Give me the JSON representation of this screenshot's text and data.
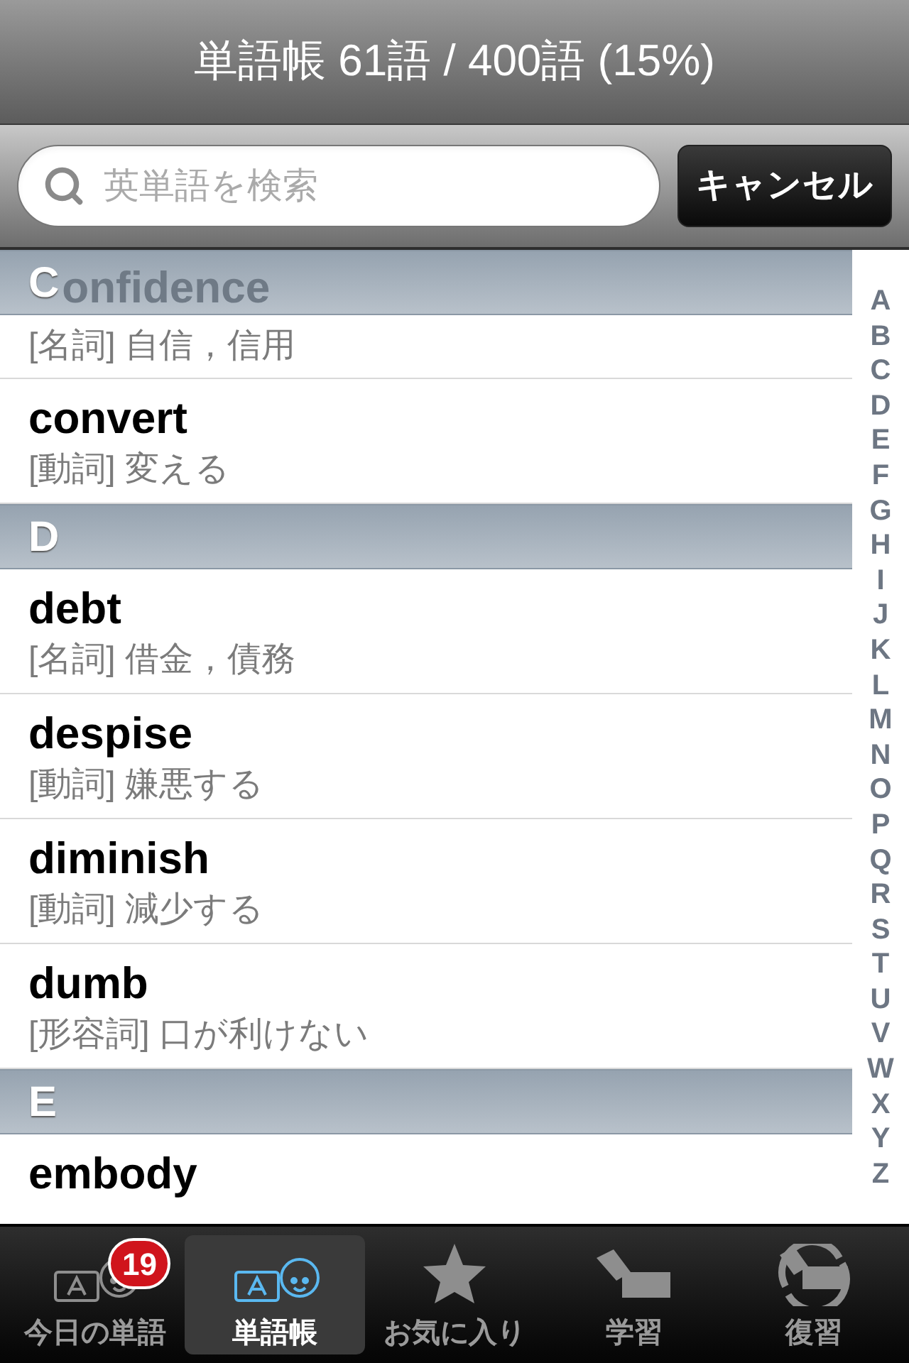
{
  "nav_bar": {
    "title": "単語帳 61語 / 400語 (15%)"
  },
  "search": {
    "placeholder": "英単語を検索",
    "cancel_button": "キャンセル"
  },
  "sections": [
    {
      "letter": "C",
      "entries": [
        {
          "kind": "scrolled_under",
          "word": "onfidence",
          "definition": "[名詞] 自信，信用"
        },
        {
          "kind": "entry",
          "word": "convert",
          "definition": "[動詞] 変える"
        }
      ]
    },
    {
      "letter": "D",
      "entries": [
        {
          "kind": "entry",
          "word": "debt",
          "definition": "[名詞] 借金，債務"
        },
        {
          "kind": "entry",
          "word": "despise",
          "definition": "[動詞] 嫌悪する"
        },
        {
          "kind": "entry",
          "word": "diminish",
          "definition": "[動詞] 減少する"
        },
        {
          "kind": "entry",
          "word": "dumb",
          "definition": "[形容詞] 口が利けない"
        }
      ]
    },
    {
      "letter": "E",
      "entries": [
        {
          "kind": "entry",
          "word": "embody"
        }
      ]
    }
  ],
  "index": [
    "A",
    "B",
    "C",
    "D",
    "E",
    "F",
    "G",
    "H",
    "I",
    "J",
    "K",
    "L",
    "M",
    "N",
    "O",
    "P",
    "Q",
    "R",
    "S",
    "T",
    "U",
    "V",
    "W",
    "X",
    "Y",
    "Z"
  ],
  "tab_bar": [
    {
      "kind": "today",
      "label": "今日の単語",
      "badge": "19",
      "selected": false
    },
    {
      "kind": "wordbook",
      "label": "単語帳",
      "selected": true
    },
    {
      "kind": "favorites",
      "label": "お気に入り",
      "selected": false
    },
    {
      "kind": "study",
      "label": "学習",
      "selected": false
    },
    {
      "kind": "review",
      "label": "復習",
      "selected": false
    }
  ]
}
